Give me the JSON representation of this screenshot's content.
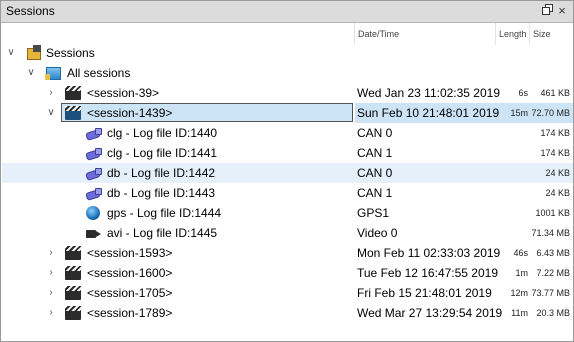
{
  "window": {
    "title": "Sessions",
    "pin_icon": "restore-icon",
    "close_label": "×"
  },
  "columns": {
    "date": "Date/Time",
    "length": "Length",
    "size": "Size"
  },
  "tree": {
    "root_label": "Sessions",
    "all_sessions_label": "All sessions",
    "rows": [
      {
        "label": "<session-39>",
        "date": "Wed Jan 23 11:02:35 2019",
        "length": "6s",
        "size": "461 KB"
      },
      {
        "label": "<session-1439>",
        "date": "Sun Feb 10 21:48:01 2019",
        "length": "15m",
        "size": "72.70 MB"
      },
      {
        "label": "clg - Log file ID:1440",
        "date": "CAN 0",
        "length": "",
        "size": "174 KB"
      },
      {
        "label": "clg - Log file ID:1441",
        "date": "CAN 1",
        "length": "",
        "size": "174 KB"
      },
      {
        "label": "db - Log file ID:1442",
        "date": "CAN 0",
        "length": "",
        "size": "24 KB"
      },
      {
        "label": "db - Log file ID:1443",
        "date": "CAN 1",
        "length": "",
        "size": "24 KB"
      },
      {
        "label": "gps - Log file ID:1444",
        "date": "GPS1",
        "length": "",
        "size": "1001 KB"
      },
      {
        "label": "avi - Log file ID:1445",
        "date": "Video 0",
        "length": "",
        "size": "71.34 MB"
      },
      {
        "label": "<session-1593>",
        "date": "Mon Feb 11 02:33:03 2019",
        "length": "46s",
        "size": "6.43 MB"
      },
      {
        "label": "<session-1600>",
        "date": "Tue Feb 12 16:47:55 2019",
        "length": "1m",
        "size": "7.22 MB"
      },
      {
        "label": "<session-1705>",
        "date": "Fri Feb 15 21:48:01 2019",
        "length": "12m",
        "size": "73.77 MB"
      },
      {
        "label": "<session-1789>",
        "date": "Wed Mar 27 13:29:54 2019",
        "length": "11m",
        "size": "20.3 MB"
      }
    ]
  }
}
